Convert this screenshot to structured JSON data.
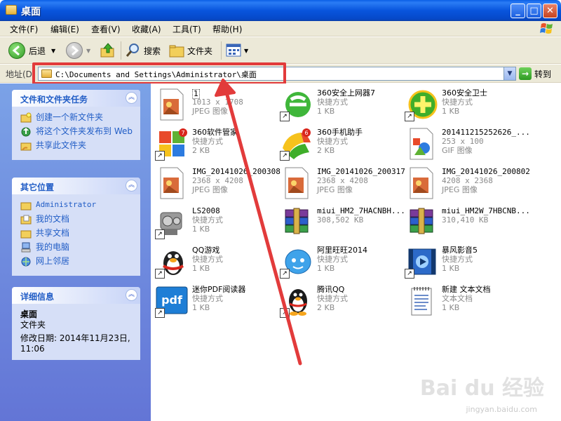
{
  "window": {
    "title": "桌面",
    "buttons": {
      "minimize": "_",
      "maximize": "□",
      "close": "✕"
    }
  },
  "menu": [
    "文件(F)",
    "编辑(E)",
    "查看(V)",
    "收藏(A)",
    "工具(T)",
    "帮助(H)"
  ],
  "toolbar": {
    "back": "后退",
    "search": "搜索",
    "folders": "文件夹"
  },
  "address": {
    "label": "地址(D)",
    "value": "C:\\Documents and Settings\\Administrator\\桌面",
    "go": "转到"
  },
  "panels": {
    "tasks": {
      "title": "文件和文件夹任务",
      "items": [
        "创建一个新文件夹",
        "将这个文件夹发布到 Web",
        "共享此文件夹"
      ]
    },
    "places": {
      "title": "其它位置",
      "items": [
        "Administrator",
        "我的文档",
        "共享文档",
        "我的电脑",
        "网上邻居"
      ]
    },
    "details": {
      "title": "详细信息",
      "name": "桌面",
      "type": "文件夹",
      "modified": "修改日期: 2014年11月23日, 11:06"
    }
  },
  "files": [
    {
      "name": "1",
      "l1": "1013 x 1708",
      "l2": "JPEG 图像",
      "icon": "jpeg-image-icon"
    },
    {
      "name": "360安全上网器7",
      "l1": "快捷方式",
      "l2": "1 KB",
      "icon": "360-browser-icon"
    },
    {
      "name": "360安全卫士",
      "l1": "快捷方式",
      "l2": "1 KB",
      "icon": "360-safeguard-icon"
    },
    {
      "name": "360软件管家",
      "l1": "快捷方式",
      "l2": "2 KB",
      "icon": "360-software-manager-icon"
    },
    {
      "name": "360手机助手",
      "l1": "快捷方式",
      "l2": "2 KB",
      "icon": "360-phone-assistant-icon"
    },
    {
      "name": "201411215252626_...",
      "l1": "253 x 100",
      "l2": "GIF 图像",
      "icon": "gif-image-icon"
    },
    {
      "name": "IMG_20141026_200308",
      "l1": "2368 x 4208",
      "l2": "JPEG 图像",
      "icon": "jpeg-image-icon"
    },
    {
      "name": "IMG_20141026_200317",
      "l1": "2368 x 4208",
      "l2": "JPEG 图像",
      "icon": "jpeg-image-icon"
    },
    {
      "name": "IMG_20141026_200802",
      "l1": "4208 x 2368",
      "l2": "JPEG 图像",
      "icon": "jpeg-image-icon"
    },
    {
      "name": "LS2008",
      "l1": "快捷方式",
      "l2": "1 KB",
      "icon": "ls2008-icon"
    },
    {
      "name": "miui_HM2_7HACNBH...",
      "l1": "308,502 KB",
      "l2": "",
      "icon": "winrar-archive-icon"
    },
    {
      "name": "miui_HM2W_7HBCNB...",
      "l1": "310,410 KB",
      "l2": "",
      "icon": "winrar-archive-icon"
    },
    {
      "name": "QQ游戏",
      "l1": "快捷方式",
      "l2": "1 KB",
      "icon": "qq-game-icon"
    },
    {
      "name": "阿里旺旺2014",
      "l1": "快捷方式",
      "l2": "1 KB",
      "icon": "aliwangwang-icon"
    },
    {
      "name": "暴风影音5",
      "l1": "快捷方式",
      "l2": "1 KB",
      "icon": "baofeng-player-icon"
    },
    {
      "name": "迷你PDF阅读器",
      "l1": "快捷方式",
      "l2": "1 KB",
      "icon": "pdf-reader-icon"
    },
    {
      "name": "腾讯QQ",
      "l1": "快捷方式",
      "l2": "2 KB",
      "icon": "qq-penguin-icon"
    },
    {
      "name": "新建 文本文档",
      "l1": "文本文档",
      "l2": "1 KB",
      "icon": "text-document-icon"
    }
  ],
  "watermark": {
    "brand": "Bai du 经验",
    "url": "jingyan.baidu.com"
  }
}
